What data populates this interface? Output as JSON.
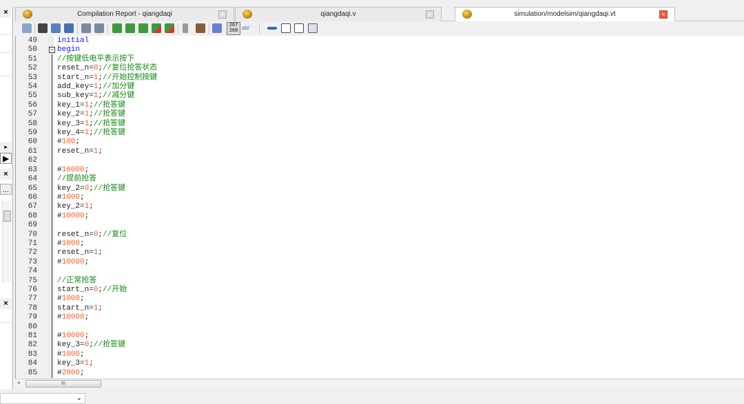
{
  "tabs": [
    {
      "label": "Compilation Report - qiangdaqi",
      "active": false
    },
    {
      "label": "qiangdaqi.v",
      "active": false
    },
    {
      "label": "simulation/modelsim/qiangdaqi.vt",
      "active": true
    }
  ],
  "left_panel": {
    "close_label": "×",
    "ellipsis_label": "..."
  },
  "toolbar": {
    "line_number_icon_label": "267\n268",
    "ab_label": "ab/"
  },
  "code": [
    {
      "n": "49",
      "t": [
        [
          "kw",
          "initial"
        ]
      ]
    },
    {
      "n": "50",
      "t": [
        [
          "kw",
          "begin"
        ]
      ]
    },
    {
      "n": "51",
      "t": [
        [
          "cm",
          "//按键低电平表示按下"
        ]
      ]
    },
    {
      "n": "52",
      "t": [
        [
          "pl",
          "reset_n="
        ],
        [
          "nu",
          "0"
        ],
        [
          "pl",
          ";"
        ],
        [
          "cm",
          "//复位抢答状态"
        ]
      ]
    },
    {
      "n": "53",
      "t": [
        [
          "pl",
          "start_n="
        ],
        [
          "nu",
          "1"
        ],
        [
          "pl",
          ";"
        ],
        [
          "cm",
          "//开始控制按键"
        ]
      ]
    },
    {
      "n": "54",
      "t": [
        [
          "pl",
          "add_key="
        ],
        [
          "nu",
          "1"
        ],
        [
          "pl",
          ";"
        ],
        [
          "cm",
          "//加分键"
        ]
      ]
    },
    {
      "n": "55",
      "t": [
        [
          "pl",
          "sub_key="
        ],
        [
          "nu",
          "1"
        ],
        [
          "pl",
          ";"
        ],
        [
          "cm",
          "//减分键"
        ]
      ]
    },
    {
      "n": "56",
      "t": [
        [
          "pl",
          "key_1="
        ],
        [
          "nu",
          "1"
        ],
        [
          "pl",
          ";"
        ],
        [
          "cm",
          "//抢答键"
        ]
      ]
    },
    {
      "n": "57",
      "t": [
        [
          "pl",
          "key_2="
        ],
        [
          "nu",
          "1"
        ],
        [
          "pl",
          ";"
        ],
        [
          "cm",
          "//抢答键"
        ]
      ]
    },
    {
      "n": "58",
      "t": [
        [
          "pl",
          "key_3="
        ],
        [
          "nu",
          "1"
        ],
        [
          "pl",
          ";"
        ],
        [
          "cm",
          "//抢答键"
        ]
      ]
    },
    {
      "n": "59",
      "t": [
        [
          "pl",
          "key_4="
        ],
        [
          "nu",
          "1"
        ],
        [
          "pl",
          ";"
        ],
        [
          "cm",
          "//抢答键"
        ]
      ]
    },
    {
      "n": "60",
      "t": [
        [
          "pl",
          "#"
        ],
        [
          "nu",
          "100"
        ],
        [
          "pl",
          ";"
        ]
      ]
    },
    {
      "n": "61",
      "t": [
        [
          "pl",
          "reset_n="
        ],
        [
          "nu",
          "1"
        ],
        [
          "pl",
          ";"
        ]
      ]
    },
    {
      "n": "62",
      "t": []
    },
    {
      "n": "63",
      "t": [
        [
          "pl",
          "#"
        ],
        [
          "nu",
          "10000"
        ],
        [
          "pl",
          ";"
        ]
      ]
    },
    {
      "n": "64",
      "t": [
        [
          "cm",
          "//提前抢答"
        ]
      ]
    },
    {
      "n": "65",
      "t": [
        [
          "pl",
          "key_2="
        ],
        [
          "nu",
          "0"
        ],
        [
          "pl",
          ";"
        ],
        [
          "cm",
          "//抢答键"
        ]
      ]
    },
    {
      "n": "66",
      "t": [
        [
          "pl",
          "#"
        ],
        [
          "nu",
          "1000"
        ],
        [
          "pl",
          ";"
        ]
      ]
    },
    {
      "n": "67",
      "t": [
        [
          "pl",
          "key_2="
        ],
        [
          "nu",
          "1"
        ],
        [
          "pl",
          ";"
        ]
      ]
    },
    {
      "n": "68",
      "t": [
        [
          "pl",
          "#"
        ],
        [
          "nu",
          "10000"
        ],
        [
          "pl",
          ";"
        ]
      ]
    },
    {
      "n": "69",
      "t": []
    },
    {
      "n": "70",
      "t": [
        [
          "pl",
          "reset_n="
        ],
        [
          "nu",
          "0"
        ],
        [
          "pl",
          ";"
        ],
        [
          "cm",
          "//复位"
        ]
      ]
    },
    {
      "n": "71",
      "t": [
        [
          "pl",
          "#"
        ],
        [
          "nu",
          "1000"
        ],
        [
          "pl",
          ";"
        ]
      ]
    },
    {
      "n": "72",
      "t": [
        [
          "pl",
          "reset_n="
        ],
        [
          "nu",
          "1"
        ],
        [
          "pl",
          ";"
        ]
      ]
    },
    {
      "n": "73",
      "t": [
        [
          "pl",
          "#"
        ],
        [
          "nu",
          "10000"
        ],
        [
          "pl",
          ";"
        ]
      ]
    },
    {
      "n": "74",
      "t": []
    },
    {
      "n": "75",
      "t": [
        [
          "cm",
          "//正常抢答"
        ]
      ]
    },
    {
      "n": "76",
      "t": [
        [
          "pl",
          "start_n="
        ],
        [
          "nu",
          "0"
        ],
        [
          "pl",
          ";"
        ],
        [
          "cm",
          "//开始"
        ]
      ]
    },
    {
      "n": "77",
      "t": [
        [
          "pl",
          "#"
        ],
        [
          "nu",
          "1000"
        ],
        [
          "pl",
          ";"
        ]
      ]
    },
    {
      "n": "78",
      "t": [
        [
          "pl",
          "start_n="
        ],
        [
          "nu",
          "1"
        ],
        [
          "pl",
          ";"
        ]
      ]
    },
    {
      "n": "79",
      "t": [
        [
          "pl",
          "#"
        ],
        [
          "nu",
          "10000"
        ],
        [
          "pl",
          ";"
        ]
      ]
    },
    {
      "n": "80",
      "t": []
    },
    {
      "n": "81",
      "t": [
        [
          "pl",
          "#"
        ],
        [
          "nu",
          "10000"
        ],
        [
          "pl",
          ";"
        ]
      ]
    },
    {
      "n": "82",
      "t": [
        [
          "pl",
          "key_3="
        ],
        [
          "nu",
          "0"
        ],
        [
          "pl",
          ";"
        ],
        [
          "cm",
          "//抢答键"
        ]
      ]
    },
    {
      "n": "83",
      "t": [
        [
          "pl",
          "#"
        ],
        [
          "nu",
          "1000"
        ],
        [
          "pl",
          ";"
        ]
      ]
    },
    {
      "n": "84",
      "t": [
        [
          "pl",
          "key_3="
        ],
        [
          "nu",
          "1"
        ],
        [
          "pl",
          ";"
        ]
      ]
    },
    {
      "n": "85",
      "t": [
        [
          "pl",
          "#"
        ],
        [
          "nu",
          "2000"
        ],
        [
          "pl",
          ";"
        ]
      ]
    }
  ],
  "scrollbar": {
    "thumb_grip": "III"
  },
  "bottom_combo": {
    "value": ""
  }
}
